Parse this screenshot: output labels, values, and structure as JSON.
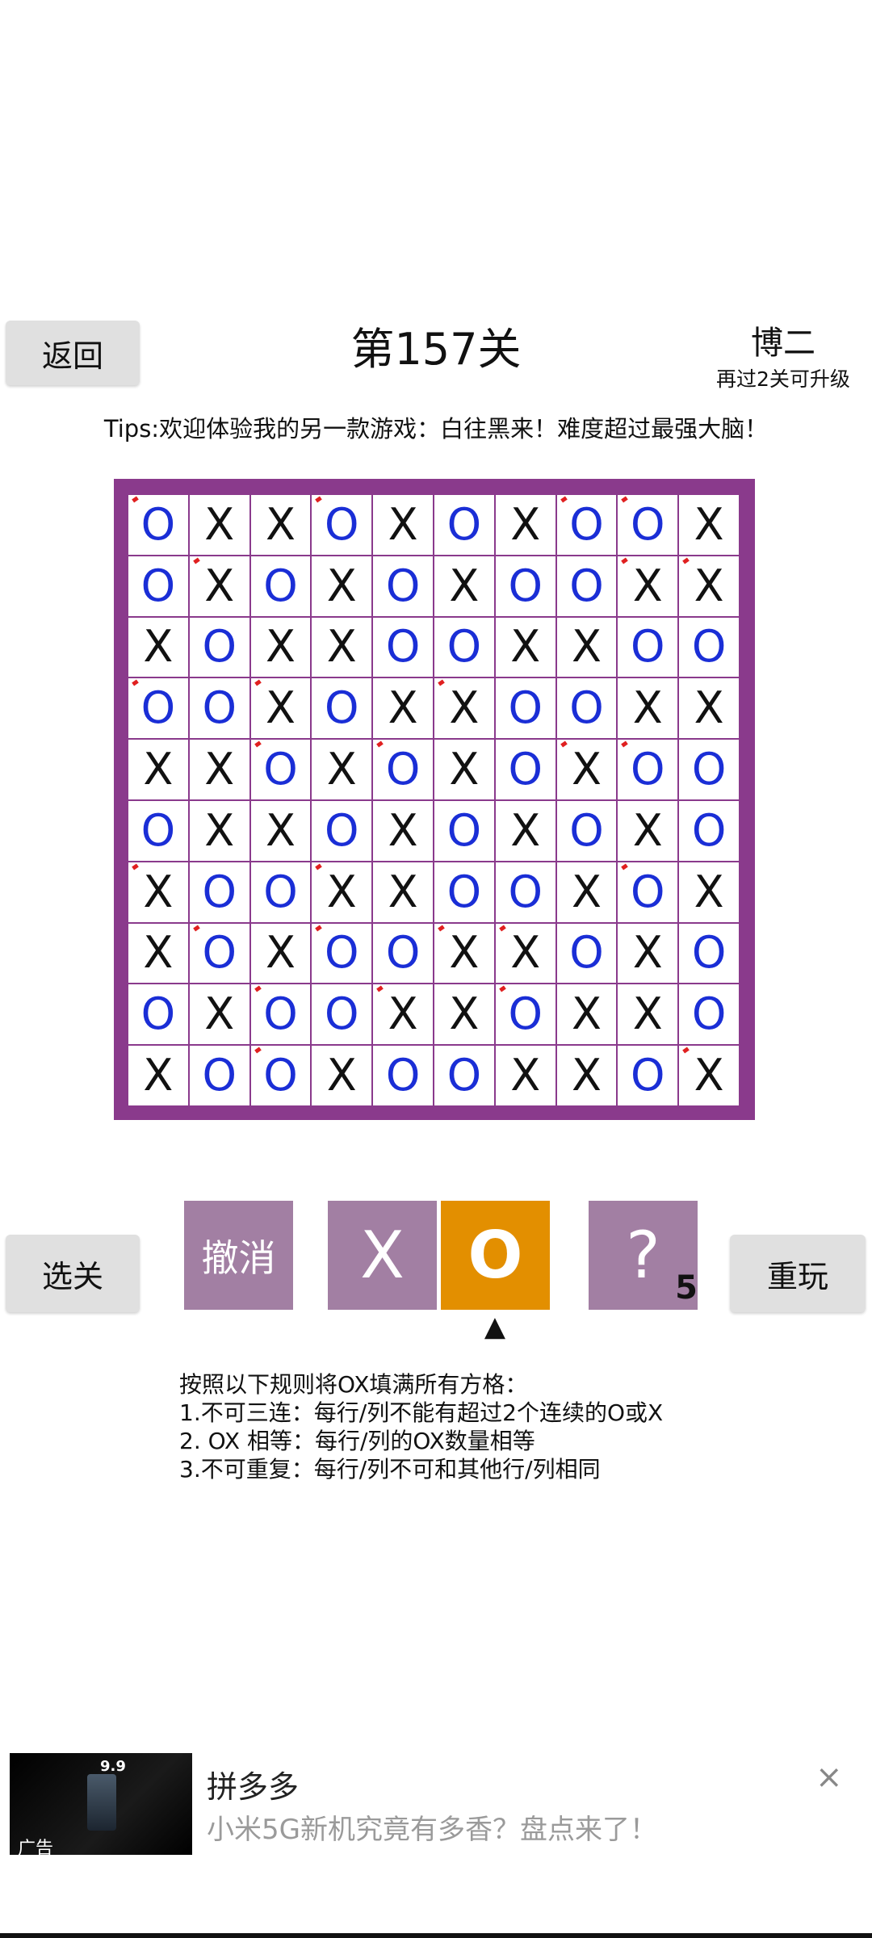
{
  "header": {
    "back_label": "返回",
    "level_title": "第157关",
    "rank": "博二",
    "upgrade_hint": "再过2关可升级"
  },
  "tips": "Tips:欢迎体验我的另一款游戏：白往黑来！难度超过最强大脑！",
  "board": {
    "rows": [
      "OXXOXOXOOX",
      "OXOXOXOOXX",
      "XOXXOOXXOO",
      "OOXOXXOOXX",
      "XXOXOXOXOO",
      "OXXOXOXOXO",
      "XOOXXOOXOX",
      "XOXOOXXOXO",
      "OXOOXXOXXO",
      "XOOXOOXXOX"
    ],
    "preset_marks": [
      "1001000110",
      "0100000011",
      "0000000000",
      "1010010000",
      "0010100110",
      "0000000000",
      "1001000010",
      "0101011000",
      "0010101000",
      "0010000001"
    ]
  },
  "controls": {
    "select_level_label": "选关",
    "undo_label": "撤消",
    "x_label": "X",
    "o_label": "O",
    "hint_label": "?",
    "hint_count": "5",
    "selected_indicator": "▲",
    "restart_label": "重玩"
  },
  "rules": {
    "intro": "按照以下规则将OX填满所有方格：",
    "rule1": "1.不可三连：每行/列不能有超过2个连续的O或X",
    "rule2": "2. OX 相等：每行/列的OX数量相等",
    "rule3": "3.不可重复：每行/列不可和其他行/列相同"
  },
  "ad": {
    "badge": "广告",
    "thumb_price": "9.9",
    "title": "拼多多",
    "description": "小米5G新机究竟有多香？盘点来了！",
    "close_icon": "×"
  }
}
